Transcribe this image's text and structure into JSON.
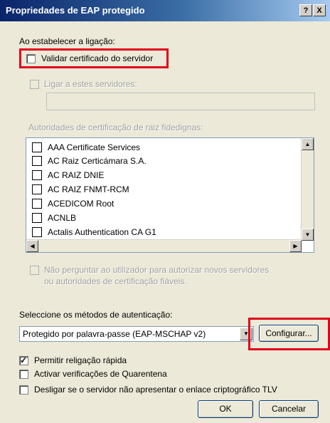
{
  "window": {
    "title": "Propriedades de EAP protegido",
    "help_label": "?",
    "close_label": "X"
  },
  "connect_section": {
    "heading": "Ao estabelecer a ligação:",
    "validate_cert_label": "Validar certificado do servidor",
    "validate_cert_checked": false,
    "connect_servers_label": "Ligar a estes servidores:",
    "servers_value": ""
  },
  "trusted_root": {
    "heading": "Autoridades de certificação de raiz fidedignas:",
    "items": [
      {
        "label": "AAA Certificate Services",
        "checked": false
      },
      {
        "label": "AC Raiz Certicámara S.A.",
        "checked": false
      },
      {
        "label": "AC RAIZ DNIE",
        "checked": false
      },
      {
        "label": "AC RAIZ FNMT-RCM",
        "checked": false
      },
      {
        "label": "ACEDICOM Root",
        "checked": false
      },
      {
        "label": "ACNLB",
        "checked": false
      },
      {
        "label": "Actalis Authentication CA G1",
        "checked": false
      }
    ]
  },
  "no_prompt": {
    "line1": "Não perguntar ao utilizador para autorizar novos servidores",
    "line2": "ou autoridades de certificação fiáveis."
  },
  "auth_method": {
    "heading": "Seleccione os métodos de autenticação:",
    "selected": "Protegido por palavra-passe (EAP-MSCHAP v2)",
    "configure_label": "Configurar..."
  },
  "options": [
    {
      "label": "Permitir religação rápida",
      "checked": true
    },
    {
      "label": "Activar verificações de Quarentena",
      "checked": false
    },
    {
      "label": "Desligar se o servidor não apresentar o enlace criptográfico TLV",
      "checked": false
    }
  ],
  "buttons": {
    "ok_label": "OK",
    "cancel_label": "Cancelar"
  },
  "highlight_color": "#e2001a"
}
